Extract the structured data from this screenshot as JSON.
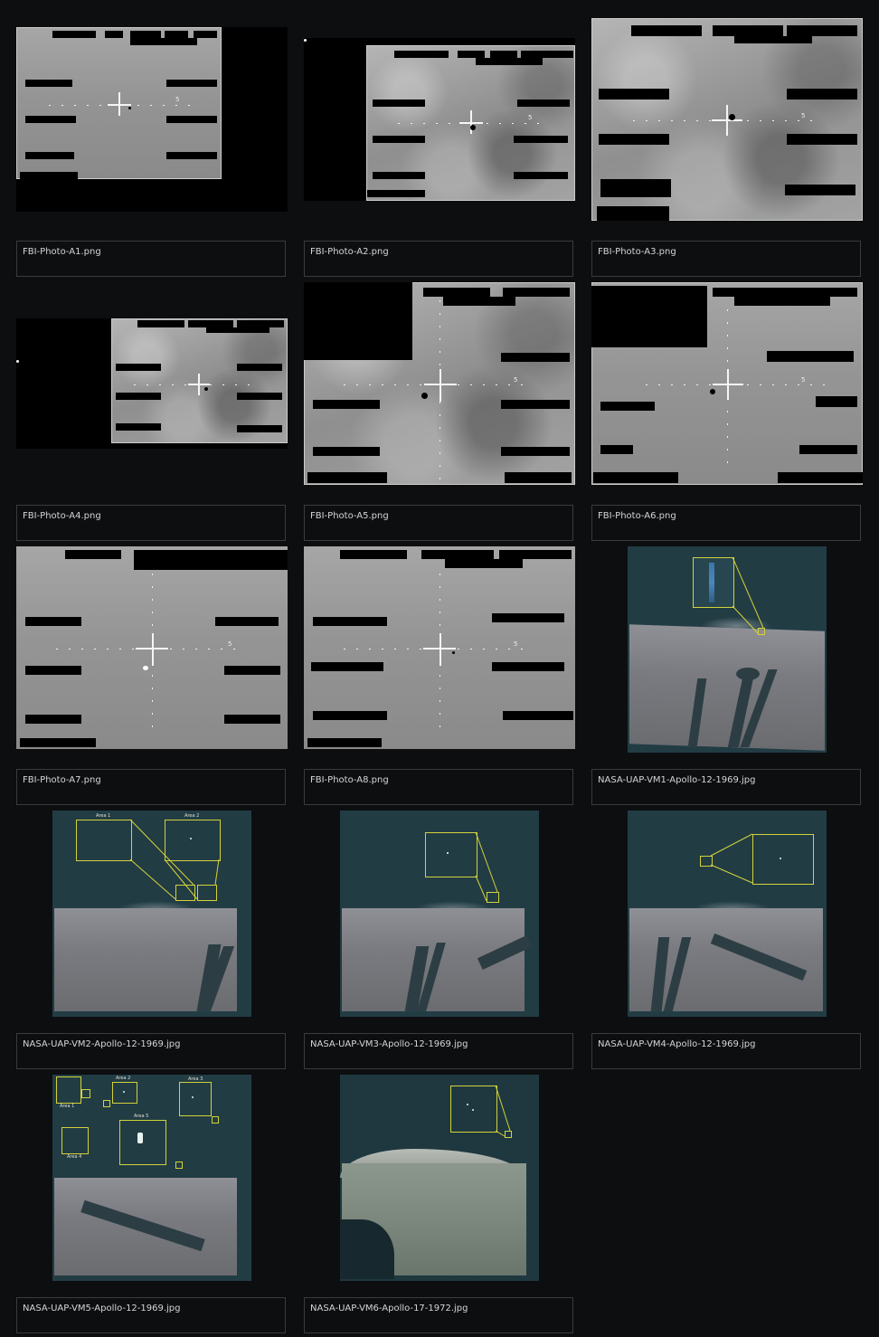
{
  "gallery": {
    "items": [
      {
        "filename": "FBI-Photo-A1.png"
      },
      {
        "filename": "FBI-Photo-A2.png"
      },
      {
        "filename": "FBI-Photo-A3.png"
      },
      {
        "filename": "FBI-Photo-A4.png"
      },
      {
        "filename": "FBI-Photo-A5.png"
      },
      {
        "filename": "FBI-Photo-A6.png"
      },
      {
        "filename": "FBI-Photo-A7.png"
      },
      {
        "filename": "FBI-Photo-A8.png"
      },
      {
        "filename": "NASA-UAP-VM1-Apollo-12-1969.jpg"
      },
      {
        "filename": "NASA-UAP-VM2-Apollo-12-1969.jpg"
      },
      {
        "filename": "NASA-UAP-VM3-Apollo-12-1969.jpg"
      },
      {
        "filename": "NASA-UAP-VM4-Apollo-12-1969.jpg"
      },
      {
        "filename": "NASA-UAP-VM5-Apollo-12-1969.jpg"
      },
      {
        "filename": "NASA-UAP-VM6-Apollo-17-1972.jpg"
      }
    ],
    "area_labels": {
      "vm2": [
        "Area 1",
        "Area 2"
      ],
      "vm5": [
        "Area 1",
        "Area 2",
        "Area 3",
        "Area 4",
        "Area 5"
      ]
    },
    "reticle_mark": "5"
  },
  "colors": {
    "background": "#0d0e10",
    "caption_border": "#3a3b3e",
    "caption_text": "#d6d6d6",
    "highlight_box": "#d3d23a",
    "nasa_sky": "#223c44"
  }
}
